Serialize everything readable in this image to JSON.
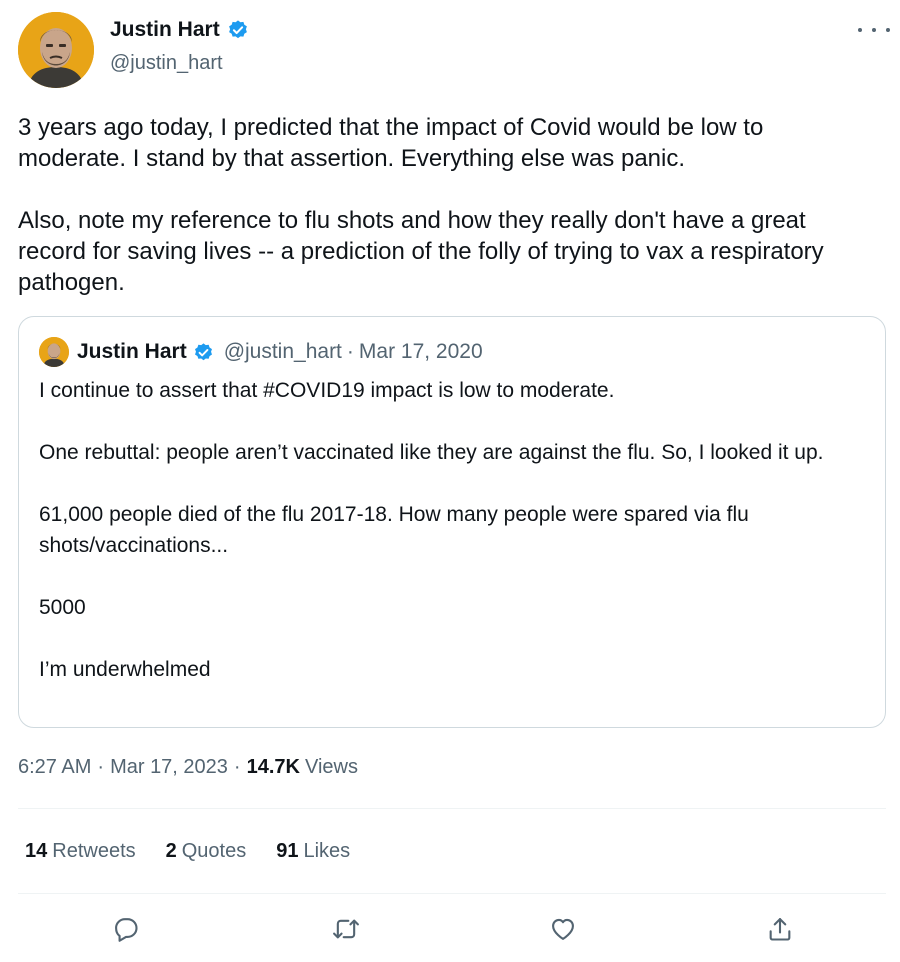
{
  "tweet": {
    "author": {
      "name": "Justin Hart",
      "handle": "@justin_hart",
      "verified": true,
      "avatar": "bearded-man-portrait-on-orange"
    },
    "text": "3 years ago today, I predicted that the impact of Covid would be low to moderate. I stand by that assertion. Everything else was panic.\n\nAlso, note my reference to flu shots and how they really don't have a great record for saving lives -- a prediction of the folly of trying to vax a respiratory pathogen.",
    "quoted": {
      "author_name": "Justin Hart",
      "handle": "@justin_hart",
      "date": "Mar 17, 2020",
      "text": "I continue to assert that #COVID19 impact is low to moderate.\n\nOne rebuttal: people aren’t vaccinated like they are against the flu. So, I looked it up.\n\n61,000 people died of the flu 2017-18. How many people were spared via flu shots/vaccinations...\n\n5000\n\nI’m underwhelmed"
    },
    "time": "6:27 AM",
    "date": "Mar 17, 2023",
    "views_count": "14.7K",
    "views_label": "Views",
    "stats": {
      "retweets_count": "14",
      "retweets_label": "Retweets",
      "quotes_count": "2",
      "quotes_label": "Quotes",
      "likes_count": "91",
      "likes_label": "Likes"
    }
  },
  "icons": {
    "more": "more-horizontal-icon",
    "verified": "verified-badge-icon",
    "reply": "reply-icon",
    "retweet": "retweet-icon",
    "like": "heart-icon",
    "share": "share-icon"
  },
  "colors": {
    "text_primary": "#0f1419",
    "text_secondary": "#536471",
    "verified_blue": "#1d9bf0",
    "border": "#cfd9de",
    "divider": "#eff3f4",
    "avatar_bg": "#e8a417"
  }
}
